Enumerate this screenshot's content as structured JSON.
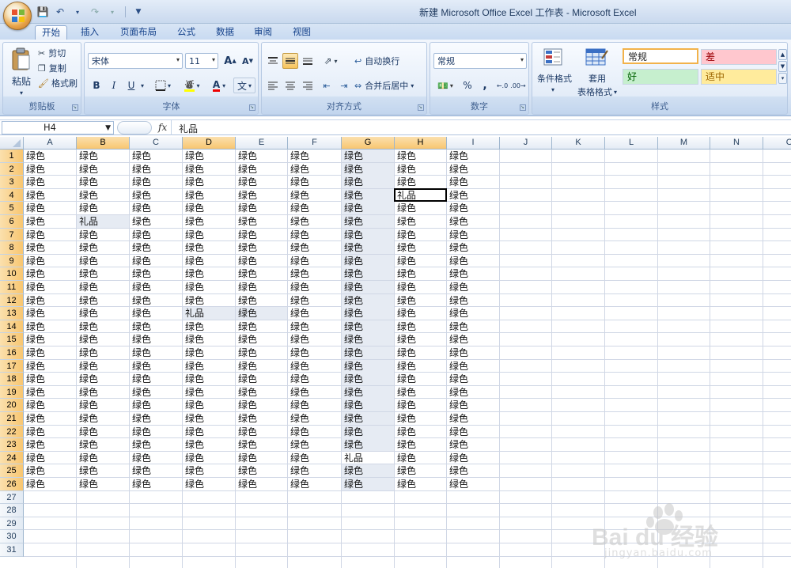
{
  "window": {
    "title": "新建 Microsoft Office Excel 工作表 - Microsoft Excel"
  },
  "ribbon_tabs": [
    "开始",
    "插入",
    "页面布局",
    "公式",
    "数据",
    "审阅",
    "视图"
  ],
  "clipboard": {
    "paste": "粘贴",
    "cut": "剪切",
    "copy": "复制",
    "format_painter": "格式刷",
    "label": "剪贴板"
  },
  "font": {
    "name": "宋体",
    "size": "11",
    "bold": "B",
    "italic": "I",
    "underline": "U",
    "label": "字体",
    "grow": "A",
    "shrink": "A",
    "phonetic": "文"
  },
  "alignment": {
    "wrap": "自动换行",
    "merge": "合并后居中",
    "label": "对齐方式"
  },
  "number": {
    "format": "常规",
    "percent": "%",
    "comma": ",",
    "label": "数字"
  },
  "styles": {
    "cond_format": "条件格式",
    "table_format_1": "套用",
    "table_format_2": "表格格式",
    "normal": "常规",
    "bad": "差",
    "good": "好",
    "neutral": "适中",
    "label": "样式"
  },
  "formula_bar": {
    "cell_ref": "H4",
    "fx": "fx",
    "value": "礼品"
  },
  "columns": [
    "A",
    "B",
    "C",
    "D",
    "E",
    "F",
    "G",
    "H",
    "I",
    "J",
    "K",
    "L",
    "M",
    "N",
    "O"
  ],
  "selected_columns": [
    "B",
    "D",
    "G",
    "H"
  ],
  "rows": [
    "1",
    "2",
    "3",
    "4",
    "5",
    "6",
    "7",
    "8",
    "9",
    "10",
    "11",
    "12",
    "13",
    "14",
    "15",
    "16",
    "17",
    "18",
    "19",
    "20",
    "21",
    "22",
    "23",
    "24",
    "25",
    "26",
    "27",
    "28",
    "29",
    "30",
    "31"
  ],
  "selected_rows": [
    "1",
    "2",
    "3",
    "4",
    "5",
    "6",
    "7",
    "8",
    "9",
    "10",
    "11",
    "12",
    "13",
    "14",
    "15",
    "16",
    "17",
    "18",
    "19",
    "20",
    "21",
    "22",
    "23",
    "24",
    "25",
    "26"
  ],
  "sheet": {
    "default_value": "绿色",
    "filled_rows": 26,
    "filled_columns": [
      "A",
      "B",
      "C",
      "D",
      "E",
      "F",
      "G",
      "H",
      "I"
    ],
    "special": [
      {
        "cell": "H4",
        "value": "礼品",
        "active": true
      },
      {
        "cell": "B6",
        "value": "礼品",
        "active": false
      },
      {
        "cell": "D13",
        "value": "礼品",
        "active": false
      },
      {
        "cell": "G24",
        "value": "礼品",
        "active": false
      }
    ],
    "highlighted_cells": [
      "B6",
      "D13",
      "E13",
      "G1",
      "G2",
      "G3",
      "G4",
      "G5",
      "G6",
      "G7",
      "G8",
      "G9",
      "G10",
      "G11",
      "G12",
      "G13",
      "G14",
      "G15",
      "G16",
      "G17",
      "G18",
      "G19",
      "G20",
      "G21",
      "G22",
      "G23",
      "G25",
      "G26"
    ]
  },
  "watermark": {
    "brand": "Bai du 经验",
    "url": "jingyan.baidu.com"
  },
  "colors": {
    "accent": "#15428b",
    "selection": "#f8c671",
    "bad_fill": "#ffc7ce",
    "good_fill": "#c6efce",
    "neutral_fill": "#ffeb9c"
  }
}
